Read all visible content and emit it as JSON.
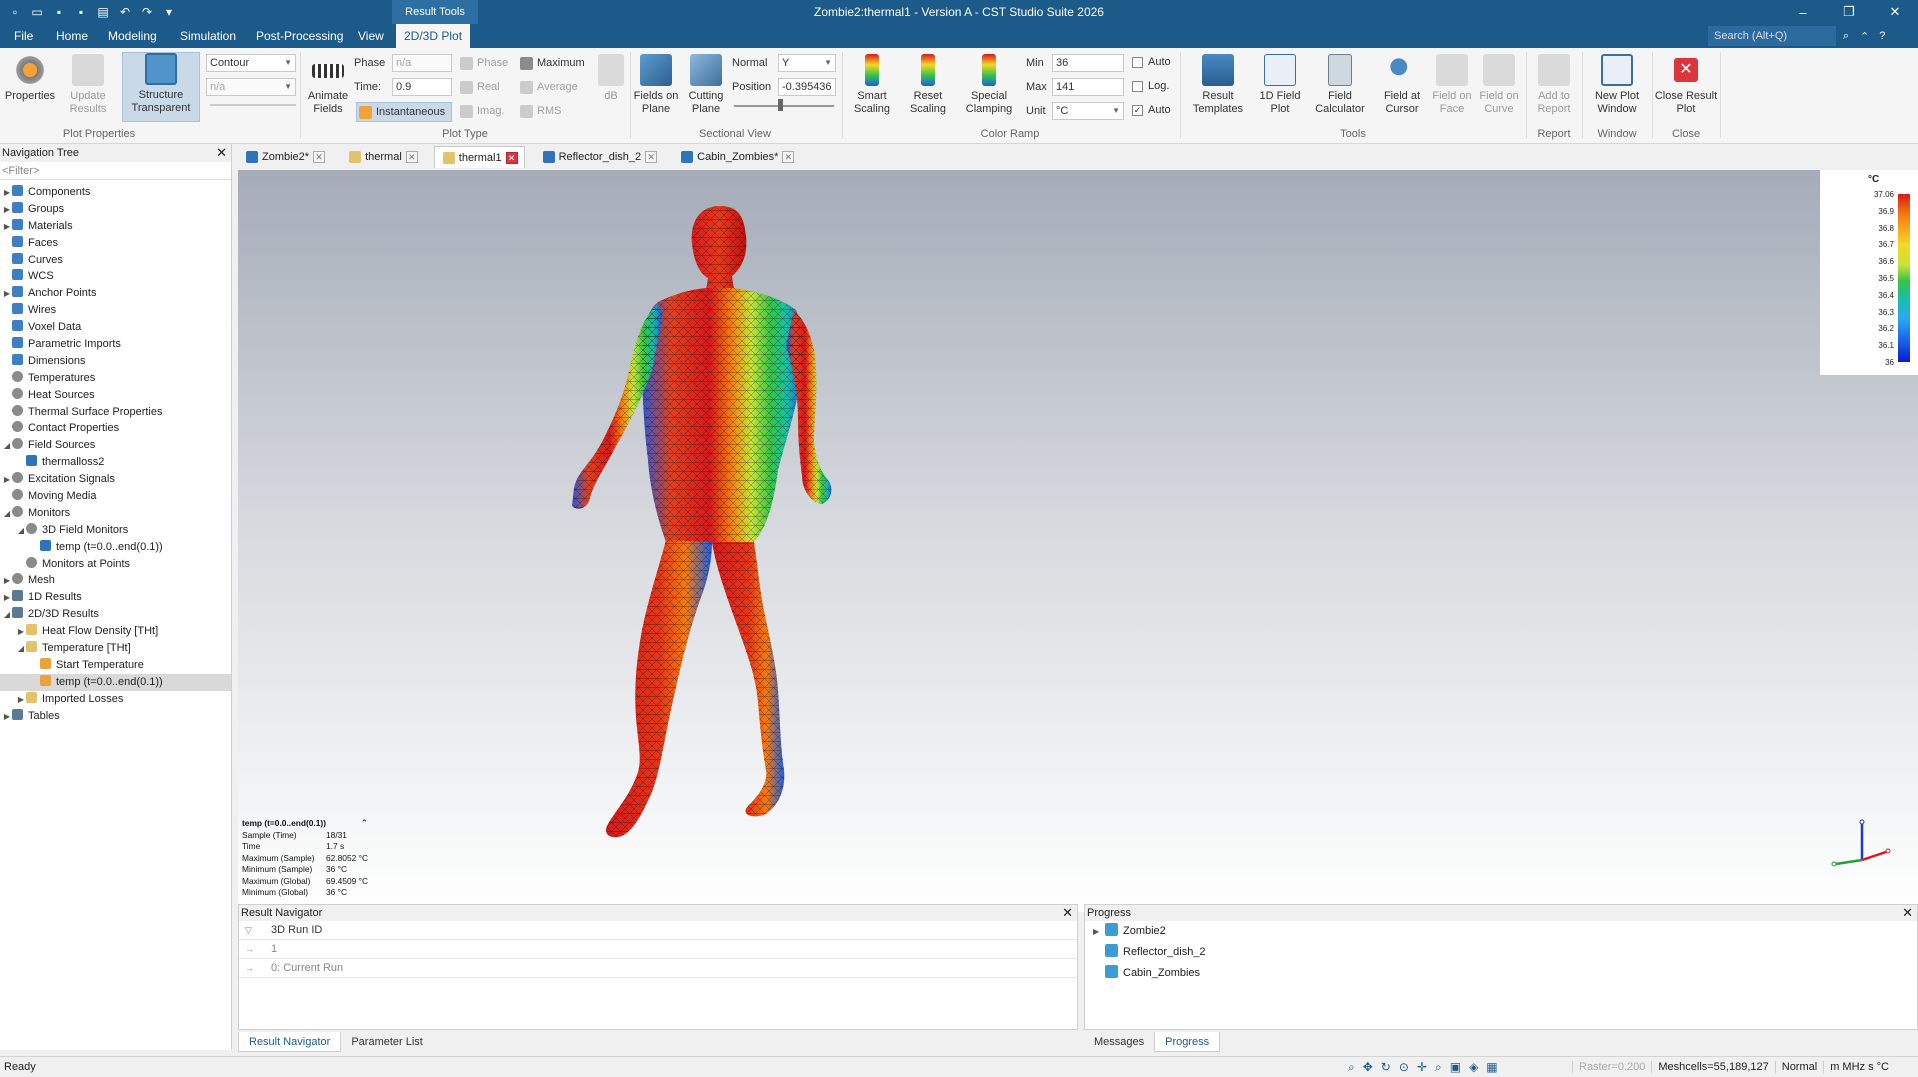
{
  "window": {
    "title": "Zombie2:thermal1 - Version A - CST Studio Suite 2026",
    "context_tab": "Result Tools",
    "controls": {
      "minimize": "–",
      "restore": "❐",
      "close": "✕"
    }
  },
  "menu": {
    "tabs": [
      "File",
      "Home",
      "Modeling",
      "Simulation",
      "Post-Processing",
      "View",
      "2D/3D Plot"
    ],
    "search_placeholder": "Search (Alt+Q)",
    "help": "?"
  },
  "ribbon": {
    "groups": [
      "Plot Properties",
      "Plot Type",
      "Sectional View",
      "Color Ramp",
      "Tools",
      "Report",
      "Window",
      "Close"
    ],
    "properties": "Properties",
    "update_results": "Update\nResults",
    "structure_transparent": "Structure\nTransparent",
    "plot_type_value": "Contour",
    "na_value": "n/a",
    "animate_fields": "Animate\nFields",
    "phase_label": "Phase",
    "phase_value": "n/a",
    "time_label": "Time:",
    "time_value": "0.9",
    "instantaneous": "Instantaneous",
    "phase_opt": "Phase",
    "real_opt": "Real",
    "imag_opt": "Imag.",
    "maximum_opt": "Maximum",
    "average_opt": "Average",
    "rms_opt": "RMS",
    "db_label": "dB",
    "fields_on_plane": "Fields on\nPlane",
    "cutting_plane": "Cutting\nPlane",
    "normal_label": "Normal",
    "normal_value": "Y",
    "position_label": "Position",
    "position_value": "-0.395436",
    "smart_scaling": "Smart\nScaling",
    "reset_scaling": "Reset\nScaling",
    "special_clamping": "Special\nClamping",
    "min_label": "Min",
    "min_value": "36",
    "max_label": "Max",
    "max_value": "141",
    "unit_label": "Unit",
    "unit_value": "°C",
    "auto1": "Auto",
    "log": "Log.",
    "auto2": "Auto",
    "result_templates": "Result\nTemplates",
    "field_1d_plot": "1D Field\nPlot",
    "field_calculator": "Field\nCalculator",
    "field_at_cursor": "Field at\nCursor",
    "field_on_face": "Field on\nFace",
    "field_on_curve": "Field on\nCurve",
    "add_to_report": "Add to\nReport",
    "new_plot_window": "New Plot\nWindow",
    "close_result_plot": "Close Result\nPlot"
  },
  "nav_tree": {
    "title": "Navigation Tree",
    "filter": "<Filter>",
    "items": [
      {
        "label": "Components",
        "level": 0,
        "arrow": "▶",
        "icon": "cube"
      },
      {
        "label": "Groups",
        "level": 0,
        "arrow": "▶",
        "icon": "cube"
      },
      {
        "label": "Materials",
        "level": 0,
        "arrow": "▶",
        "icon": "cube"
      },
      {
        "label": "Faces",
        "level": 0,
        "arrow": "",
        "icon": "cube"
      },
      {
        "label": "Curves",
        "level": 0,
        "arrow": "",
        "icon": "cube"
      },
      {
        "label": "WCS",
        "level": 0,
        "arrow": "",
        "icon": "cube"
      },
      {
        "label": "Anchor Points",
        "level": 0,
        "arrow": "▶",
        "icon": "cube"
      },
      {
        "label": "Wires",
        "level": 0,
        "arrow": "",
        "icon": "cube"
      },
      {
        "label": "Voxel Data",
        "level": 0,
        "arrow": "",
        "icon": "cube"
      },
      {
        "label": "Parametric Imports",
        "level": 0,
        "arrow": "",
        "icon": "cube"
      },
      {
        "label": "Dimensions",
        "level": 0,
        "arrow": "",
        "icon": "cube"
      },
      {
        "label": "Temperatures",
        "level": 0,
        "arrow": "",
        "icon": "gear"
      },
      {
        "label": "Heat Sources",
        "level": 0,
        "arrow": "",
        "icon": "gear"
      },
      {
        "label": "Thermal Surface Properties",
        "level": 0,
        "arrow": "",
        "icon": "gear"
      },
      {
        "label": "Contact Properties",
        "level": 0,
        "arrow": "",
        "icon": "gear"
      },
      {
        "label": "Field Sources",
        "level": 0,
        "arrow": "◢",
        "icon": "gear"
      },
      {
        "label": "thermalloss2",
        "level": 1,
        "arrow": "",
        "icon": "blue"
      },
      {
        "label": "Excitation Signals",
        "level": 0,
        "arrow": "▶",
        "icon": "gear"
      },
      {
        "label": "Moving Media",
        "level": 0,
        "arrow": "",
        "icon": "gear"
      },
      {
        "label": "Monitors",
        "level": 0,
        "arrow": "◢",
        "icon": "gear"
      },
      {
        "label": "3D Field Monitors",
        "level": 1,
        "arrow": "◢",
        "icon": "gear"
      },
      {
        "label": "temp (t=0.0..end(0.1))",
        "level": 2,
        "arrow": "",
        "icon": "blue"
      },
      {
        "label": "Monitors at Points",
        "level": 1,
        "arrow": "",
        "icon": "gear"
      },
      {
        "label": "Mesh",
        "level": 0,
        "arrow": "▶",
        "icon": "gear"
      },
      {
        "label": "1D Results",
        "level": 0,
        "arrow": "▶",
        "icon": "res"
      },
      {
        "label": "2D/3D Results",
        "level": 0,
        "arrow": "◢",
        "icon": "res"
      },
      {
        "label": "Heat Flow Density [THt]",
        "level": 1,
        "arrow": "▶",
        "icon": "folder"
      },
      {
        "label": "Temperature [THt]",
        "level": 1,
        "arrow": "◢",
        "icon": "folder"
      },
      {
        "label": "Start Temperature",
        "level": 2,
        "arrow": "",
        "icon": "multi"
      },
      {
        "label": "temp (t=0.0..end(0.1))",
        "level": 2,
        "arrow": "",
        "icon": "multi",
        "selected": true
      },
      {
        "label": "Imported Losses",
        "level": 1,
        "arrow": "▶",
        "icon": "folder"
      },
      {
        "label": "Tables",
        "level": 0,
        "arrow": "▶",
        "icon": "res"
      }
    ]
  },
  "doc_tabs": [
    {
      "label": "Zombie2*",
      "active": false
    },
    {
      "label": "thermal",
      "active": false
    },
    {
      "label": "thermal1",
      "active": true
    },
    {
      "label": "Reflector_dish_2",
      "active": false
    },
    {
      "label": "Cabin_Zombies*",
      "active": false
    }
  ],
  "legend": {
    "unit": "°C",
    "ticks": [
      "37.06",
      "36.9",
      "36.8",
      "36.7",
      "36.6",
      "36.5",
      "36.4",
      "36.3",
      "36.2",
      "36.1",
      "36"
    ]
  },
  "info": {
    "title": "temp (t=0.0..end(0.1))",
    "rows": [
      {
        "k": "Sample (Time)",
        "v": "18/31"
      },
      {
        "k": "Time",
        "v": "1.7 s"
      },
      {
        "k": "Maximum (Sample)",
        "v": "62.8052 °C"
      },
      {
        "k": "Minimum (Sample)",
        "v": "36 °C"
      },
      {
        "k": "Maximum (Global)",
        "v": "69.4509 °C"
      },
      {
        "k": "Minimum (Global)",
        "v": "36 °C"
      }
    ]
  },
  "result_nav": {
    "title": "Result Navigator",
    "header": "3D Run ID",
    "rows": [
      "1",
      "0: Current Run"
    ]
  },
  "progress": {
    "title": "Progress",
    "items": [
      "Zombie2",
      "Reflector_dish_2",
      "Cabin_Zombies"
    ]
  },
  "bottom_tabs_left": [
    "Result Navigator",
    "Parameter List"
  ],
  "bottom_tabs_right": [
    "Messages",
    "Progress"
  ],
  "status": {
    "text": "Ready",
    "raster": "Raster=0.200",
    "meshcells": "Meshcells=55,189,127",
    "mode": "Normal",
    "units": "m  MHz  s  °C"
  }
}
